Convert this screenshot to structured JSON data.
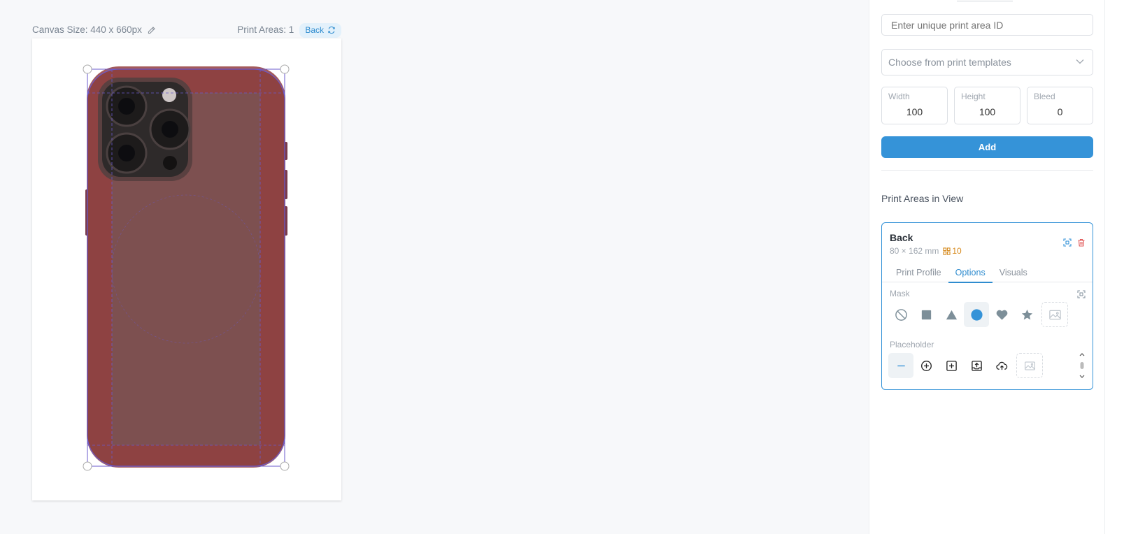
{
  "canvas": {
    "size_label": "Canvas Size: 440 x 660px",
    "print_areas_label": "Print Areas: 1",
    "current_view": "Back"
  },
  "panel": {
    "print_area_id_placeholder": "Enter unique print area ID",
    "template_select": "Choose from print templates",
    "width_label": "Width",
    "width_value": "100",
    "height_label": "Height",
    "height_value": "100",
    "bleed_label": "Bleed",
    "bleed_value": "0",
    "add_label": "Add",
    "section_title": "Print Areas in View"
  },
  "area_card": {
    "name": "Back",
    "dimensions": "80 × 162 mm",
    "dpi": "10",
    "tabs": [
      "Print Profile",
      "Options",
      "Visuals"
    ],
    "active_tab": "Options",
    "mask_label": "Mask",
    "mask_options": [
      "no-mask-icon",
      "square-icon",
      "triangle-icon",
      "circle-icon",
      "heart-icon",
      "star-icon",
      "image-icon"
    ],
    "mask_selected": "circle-icon",
    "placeholder_label": "Placeholder",
    "placeholder_options": [
      "minus-icon",
      "plus-circle-icon",
      "plus-square-icon",
      "upload-tray-icon",
      "cloud-upload-icon",
      "image-icon"
    ],
    "placeholder_selected": "minus-icon"
  },
  "colors": {
    "accent": "#3593d8",
    "overlay": "#8b3f3f",
    "selection": "#6a5acd",
    "dpi_warning": "#d6891b",
    "delete": "#e05555"
  }
}
